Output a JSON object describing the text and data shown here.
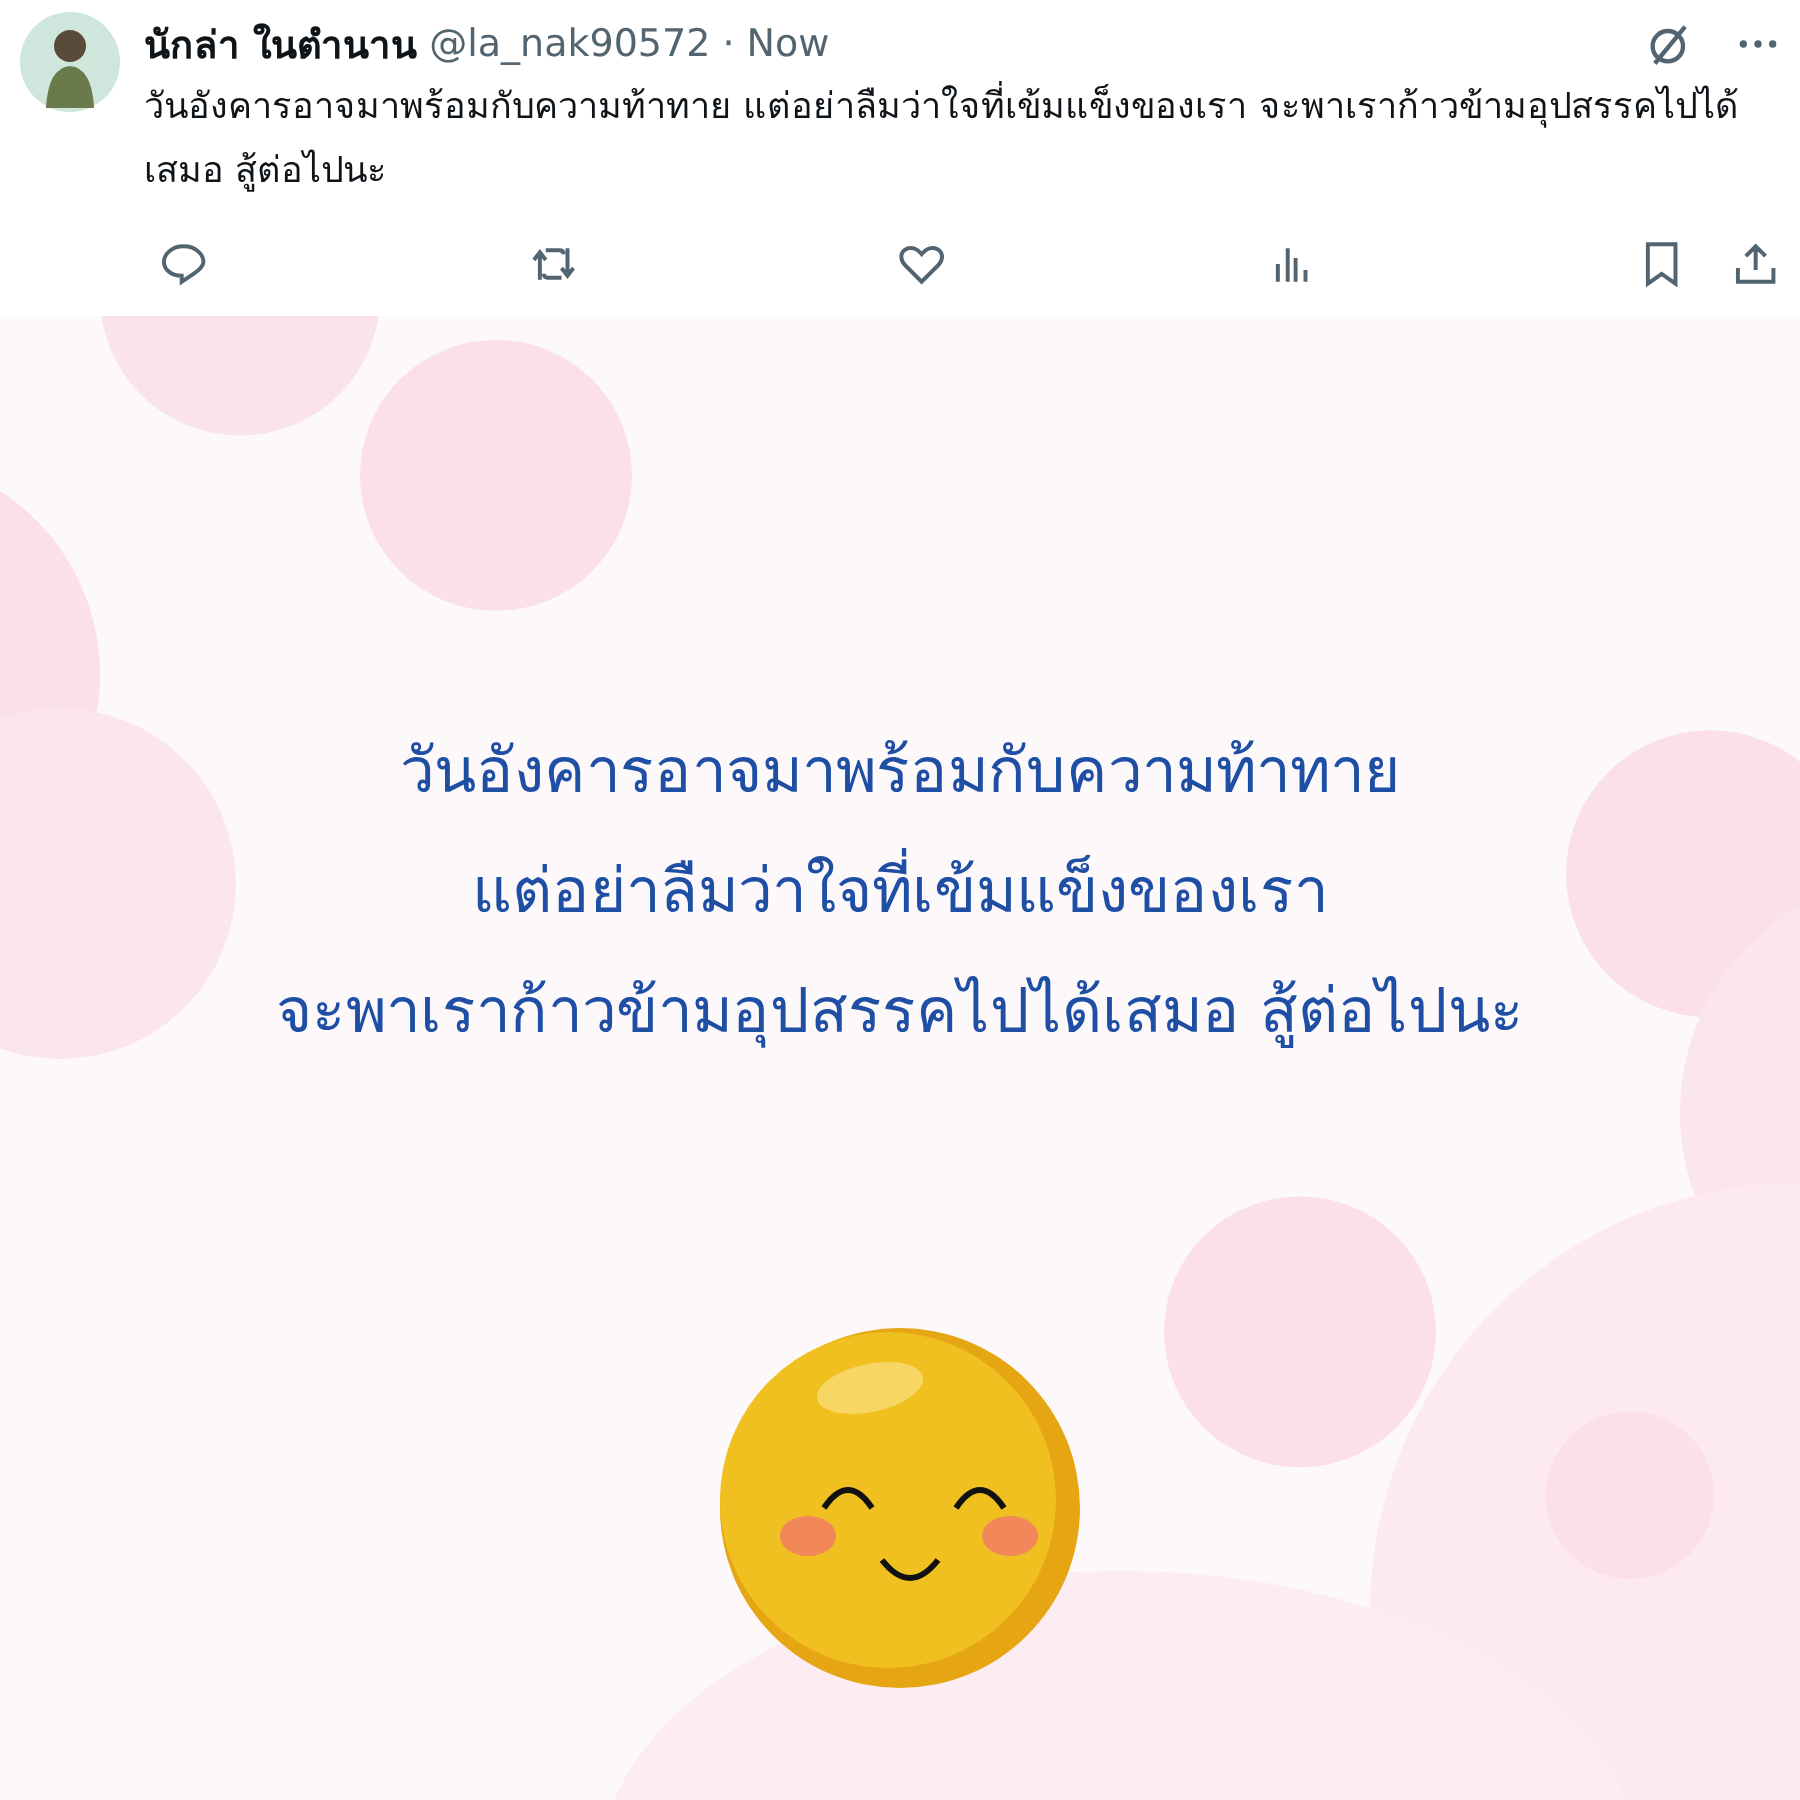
{
  "post": {
    "author": "นักล่า ในตำนาน",
    "handle": "@la_nak90572",
    "separator": "·",
    "time": "Now",
    "text": "วันอังคารอาจมาพร้อมกับความท้าทาย แต่อย่าลืมว่าใจที่เข้มแข็งของเรา จะพาเราก้าวข้ามอุปสรรคไปได้เสมอ สู้ต่อไปนะ"
  },
  "actions": [
    {
      "kind": "reply"
    },
    {
      "kind": "repost"
    },
    {
      "kind": "like"
    },
    {
      "kind": "views"
    },
    {
      "kind": "bookmark"
    },
    {
      "kind": "share"
    }
  ],
  "image": {
    "lines": [
      "วันอังคารอาจมาพร้อมกับความท้าทาย",
      "แต่อย่าลืมว่าใจที่เข้มแข็งของเรา",
      "จะพาเราก้าวข้ามอุปสรรคไปได้เสมอ  สู้ต่อไปนะ"
    ]
  }
}
